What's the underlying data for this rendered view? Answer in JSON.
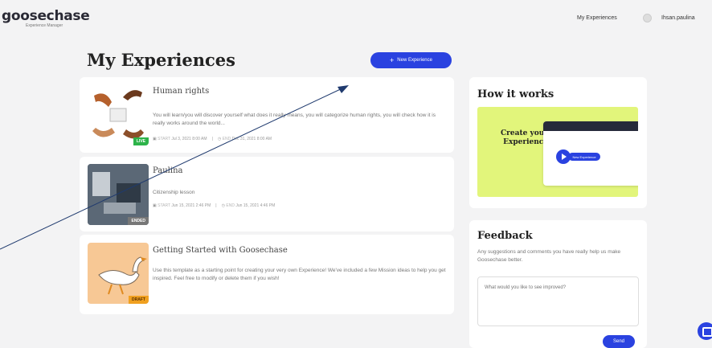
{
  "header": {
    "logo": "goosechase",
    "logo_sub": "Experience Manager",
    "nav_link": "My Experiences",
    "user": "Ihsan.paulina"
  },
  "main": {
    "title": "My Experiences",
    "new_button": "New Experience",
    "new_button_icon": "plus-icon",
    "experiences": [
      {
        "title": "Human rights",
        "description": "You will learn/you will discover yourself what does it really means, you will categorize human rights, you will check how it is really works around the world...",
        "start_label": "START",
        "start": "Jul 3, 2021 8:00 AM",
        "end_label": "END",
        "end": "Dec 31, 2021 8:00 AM",
        "badge": "LIVE"
      },
      {
        "title": "Paulina",
        "description": "Citizenship lesson",
        "start_label": "START",
        "start": "Jun 15, 2021 2:46 PM",
        "end_label": "END",
        "end": "Jun 15, 2021 4:46 PM",
        "badge": "ENDED"
      },
      {
        "title": "Getting Started with Goosechase",
        "description": "Use this template as a starting point for creating your very own Experience! We've included a few Mission ideas to help you get inspired. Feel free to modify or delete them if you wish!",
        "badge": "DRAFT"
      }
    ]
  },
  "how_it_works": {
    "title": "How it works",
    "media_text": "Create your Experience",
    "pill_text": "New Experience"
  },
  "feedback": {
    "title": "Feedback",
    "description": "Any suggestions and comments you have really help us make Goosechase better.",
    "placeholder": "What would you like to see improved?",
    "send_label": "Send"
  },
  "colors": {
    "accent": "#2a42e0",
    "live": "#2db34a",
    "draft": "#f0a020",
    "how_bg": "#e2f57b"
  }
}
